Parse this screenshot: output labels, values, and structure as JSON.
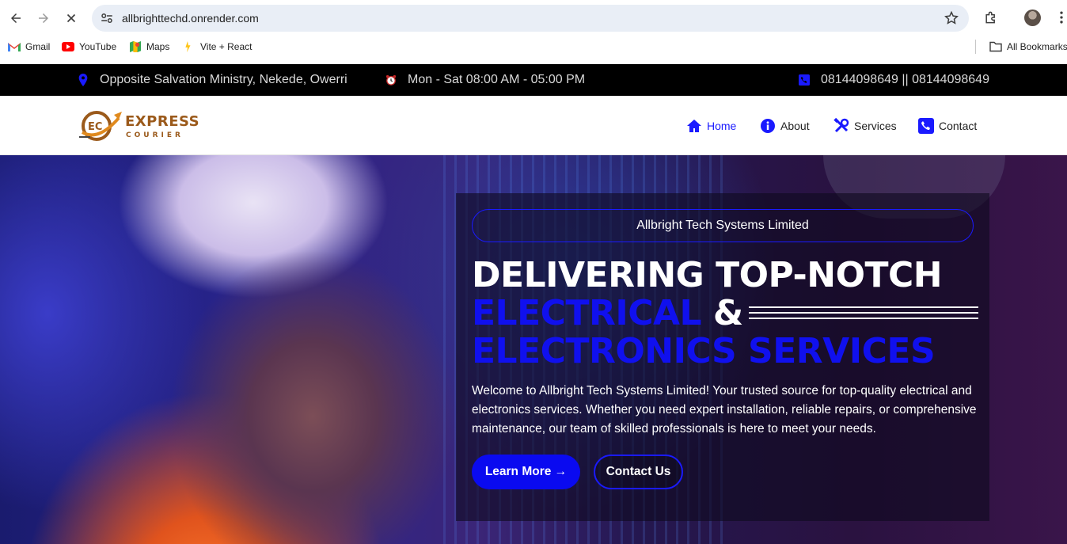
{
  "browser": {
    "url": "allbrighttechd.onrender.com",
    "bookmarks": [
      {
        "label": "Gmail",
        "icon": "gmail-icon"
      },
      {
        "label": "YouTube",
        "icon": "youtube-icon"
      },
      {
        "label": "Maps",
        "icon": "maps-icon"
      },
      {
        "label": "Vite + React",
        "icon": "vite-icon"
      }
    ],
    "all_bookmarks": "All Bookmarks"
  },
  "topbar": {
    "address": "Opposite Salvation Ministry, Nekede, Owerri",
    "hours": "Mon - Sat 08:00 AM - 05:00 PM",
    "phone": "08144098649 || 08144098649"
  },
  "logo": {
    "line1": "EXPRESS",
    "line2": "COURIER",
    "badge": "EC"
  },
  "nav": {
    "items": [
      {
        "label": "Home",
        "icon": "home-icon",
        "active": true
      },
      {
        "label": "About",
        "icon": "info-icon",
        "active": false
      },
      {
        "label": "Services",
        "icon": "tools-icon",
        "active": false
      },
      {
        "label": "Contact",
        "icon": "phone-icon",
        "active": false
      }
    ]
  },
  "hero": {
    "tagline": "Allbright Tech Systems Limited",
    "headline_line1": "DELIVERING TOP-NOTCH",
    "headline_line2_blue": "ELECTRICAL",
    "headline_line2_white": " &",
    "headline_line3": "ELECTRONICS SERVICES",
    "description": "Welcome to Allbright Tech Systems Limited! Your trusted source for top-quality electrical and electronics services. Whether you need expert installation, reliable repairs, or comprehensive maintenance, our team of skilled professionals is here to meet your needs.",
    "primary_button": "Learn More →",
    "secondary_button": "Contact Us"
  },
  "colors": {
    "accent": "#1a1aff",
    "topbar_bg": "#000000",
    "logo_brown": "#9b5a1b"
  }
}
